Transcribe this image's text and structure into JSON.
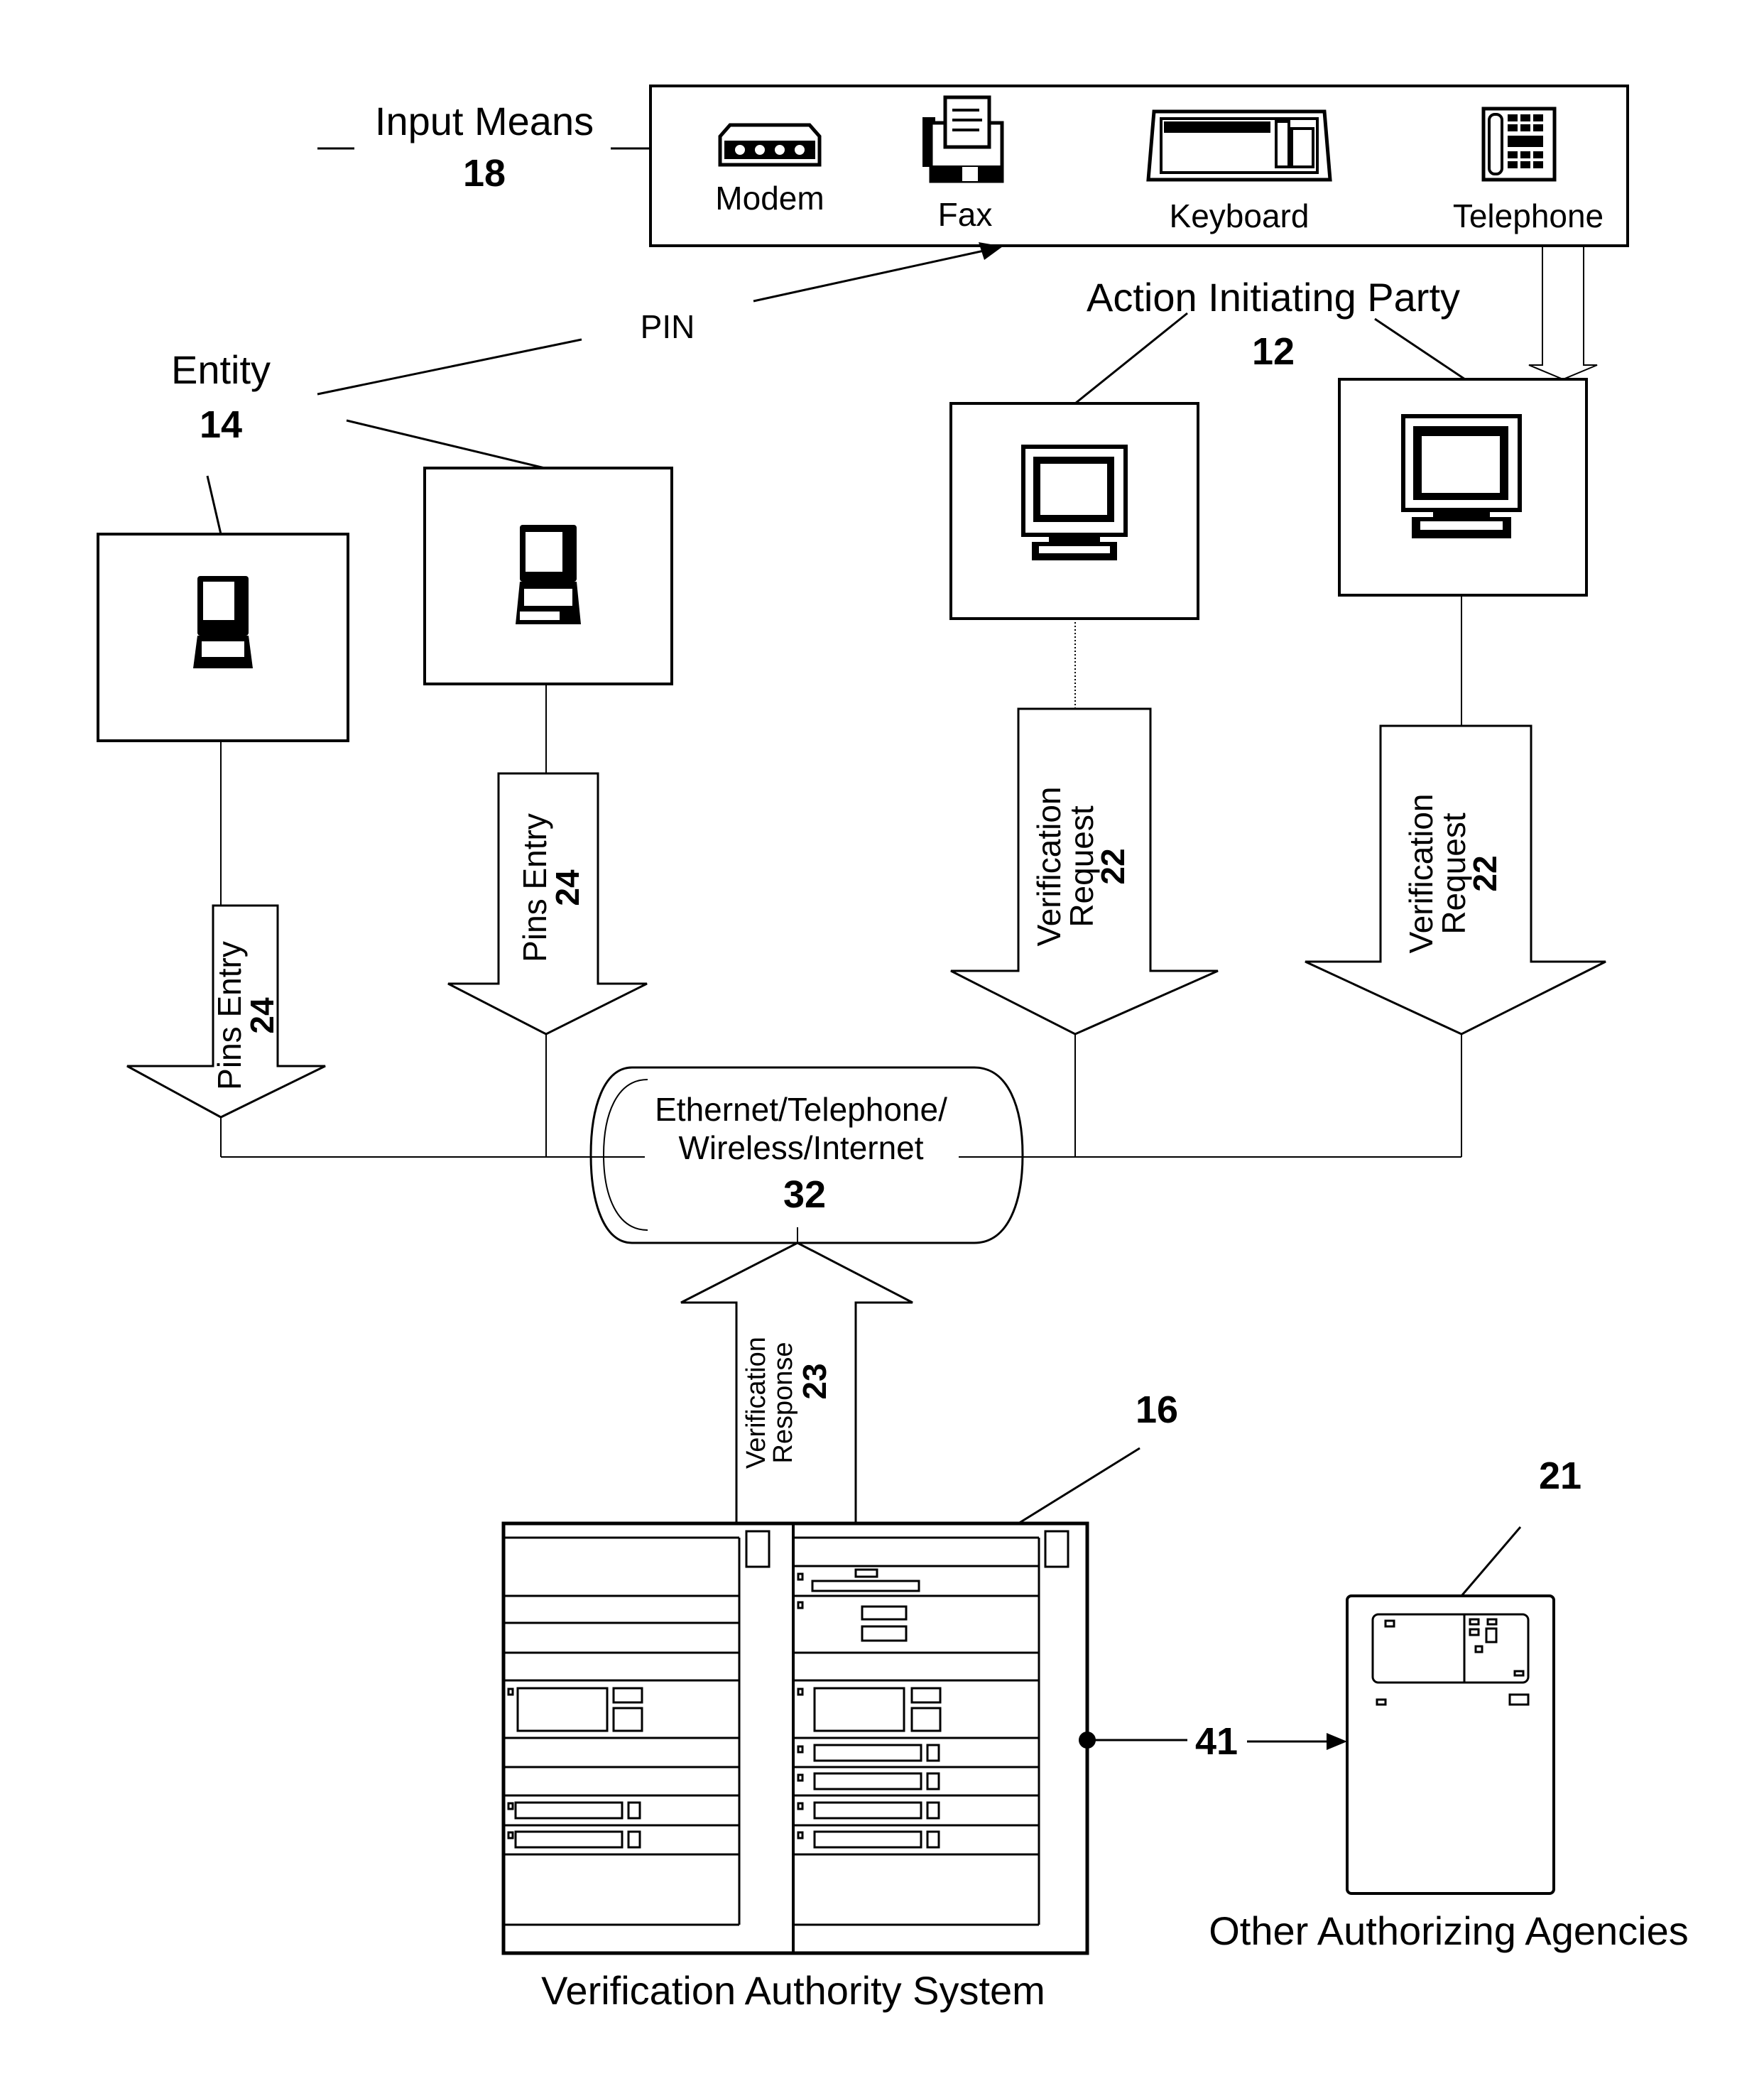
{
  "figure": {
    "input_means": {
      "label": "Input Means",
      "ref": "18",
      "devices": [
        {
          "name": "Modem",
          "icon": "modem-icon"
        },
        {
          "name": "Fax",
          "icon": "fax-icon"
        },
        {
          "name": "Keyboard",
          "icon": "keyboard-icon"
        },
        {
          "name": "Telephone",
          "icon": "telephone-icon"
        }
      ]
    },
    "pin_label": "PIN",
    "entity": {
      "label": "Entity",
      "ref": "14",
      "terminals": [
        {
          "icon": "laptop-icon"
        },
        {
          "icon": "laptop-icon"
        }
      ]
    },
    "action_initiating_party": {
      "label": "Action Initiating Party",
      "ref": "12",
      "terminals": [
        {
          "icon": "desktop-computer-icon"
        },
        {
          "icon": "desktop-computer-icon"
        }
      ]
    },
    "arrows": {
      "pins_entry": [
        {
          "label": "Pins Entry",
          "ref": "24"
        },
        {
          "label": "Pins Entry",
          "ref": "24"
        }
      ],
      "verification_request": [
        {
          "label1": "Verification",
          "label2": "Request",
          "ref": "22"
        },
        {
          "label1": "Verification",
          "label2": "Request",
          "ref": "22"
        }
      ],
      "verification_response": {
        "label1": "Verification",
        "label2": "Response",
        "ref": "23"
      }
    },
    "network": {
      "line1": "Ethernet/Telephone/",
      "line2": "Wireless/Internet",
      "ref": "32"
    },
    "verification_authority": {
      "caption": "Verification Authority System",
      "ref": "16",
      "icon": "server-rack-icon"
    },
    "other_agencies": {
      "caption": "Other Authorizing Agencies",
      "ref": "21",
      "icon": "server-cabinet-icon"
    },
    "link_ref": "41"
  }
}
